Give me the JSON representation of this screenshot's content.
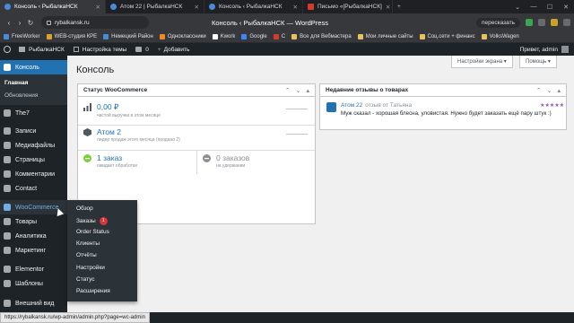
{
  "browser": {
    "tabs": [
      {
        "title": "Консоль ‹ РыбалкаНСК",
        "active": true
      },
      {
        "title": "Атом 22 | РыбалкаНСК",
        "active": false
      },
      {
        "title": "Консоль ‹ РыбалкаНСК",
        "active": false
      },
      {
        "title": "Письмо «[РыбалкаНСК]",
        "active": false
      }
    ],
    "url": "rybalkansk.ru",
    "page_title": "Консоль ‹ РыбалкаНСК — WordPress",
    "translate_label": "пересказать",
    "bookmarks": [
      "FreeWorker",
      "WEB-студия КРЕ",
      "Немецкий Район",
      "Одноклассники",
      "Kwork",
      "Google",
      "C",
      "Все для Вебмастера",
      "Мои личные сайты",
      "Соц.сети + финанс",
      "VolksWagen"
    ]
  },
  "admin_bar": {
    "site_name": "РыбалкаНСК",
    "customize": "Настройка темы",
    "comments_count": "0",
    "add_new": "Добавить",
    "greeting": "Привет, admin"
  },
  "sidebar": {
    "console": "Консоль",
    "sub_main": "Главная",
    "sub_updates": "Обновления",
    "items": [
      "The7",
      "Записи",
      "Медиафайлы",
      "Страницы",
      "Комментарии",
      "Contact",
      "WooCommerce",
      "Товары",
      "Аналитика",
      "Маркетинг",
      "Elementor",
      "Шаблоны",
      "Внешний вид"
    ]
  },
  "flyout": {
    "items": [
      "Обзор",
      "Заказы",
      "Order Status",
      "Клиенты",
      "Отчёты",
      "Настройки",
      "Статус",
      "Расширения"
    ],
    "orders_badge": "1"
  },
  "main": {
    "title": "Консоль",
    "screen_options": "Настройки экрана ▾",
    "help": "Помощь ▾"
  },
  "woo_status": {
    "title": "Статус WooCommerce",
    "sales_value": "0,00 ₽",
    "sales_label": "чистой выручки в этом месяце",
    "top_value": "Атом 2",
    "top_label": "лидер продаж этого месяца (продано 2)",
    "processing_value": "1 заказ",
    "processing_label": "ожидает обработки",
    "hold_value": "0 заказов",
    "hold_label": "на удержании"
  },
  "reviews": {
    "title": "Недавние отзывы о товарах",
    "product": "Атом 22",
    "by": "отзыв от Татьяна",
    "stars": "★★★★★",
    "text": "Муж сказал - хорошая блесна, уловистая. Нужно будет заказать ещё пару штук :)"
  },
  "status_url": "https://rybalkansk.ru/wp-admin/admin.php?page=wc-admin",
  "colors": {
    "wp_sidebar": "#1d2327",
    "wp_blue": "#2271b1",
    "badge_red": "#d63638",
    "star_purple": "#8c57b8"
  }
}
